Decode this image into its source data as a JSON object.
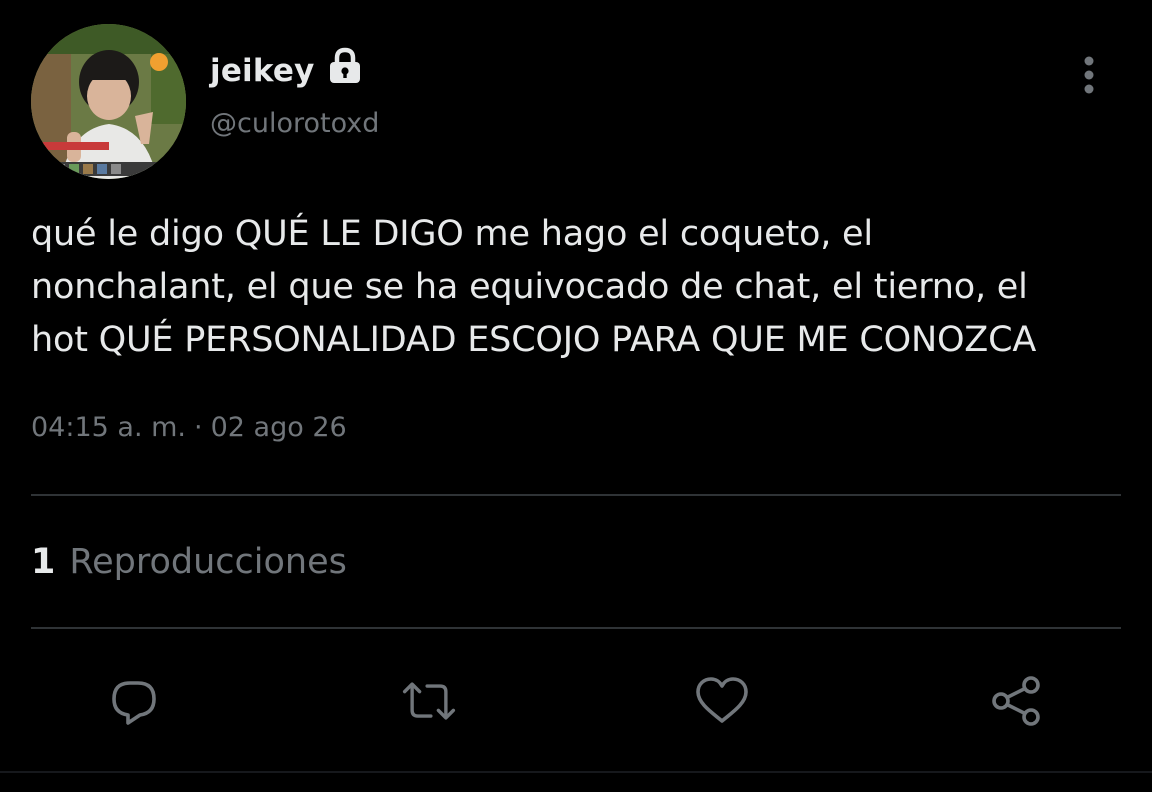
{
  "author": {
    "display_name": "jeikey",
    "handle": "@culorotoxd",
    "protected": true
  },
  "icons": {
    "lock": "lock-icon",
    "more": "more-vertical-icon",
    "reply": "reply-icon",
    "retweet": "retweet-icon",
    "like": "heart-icon",
    "share": "share-icon"
  },
  "tweet": {
    "text": "qué le digo QUÉ LE DIGO me hago el coqueto, el\nnonchalant, el que se ha equivocado de chat, el tierno, el\nhot QUÉ PERSONALIDAD ESCOJO PARA QUE ME CONOZCA",
    "time": "04:15 a. m.",
    "separator": "·",
    "date": "02 ago 26"
  },
  "stats": {
    "views_count": "1",
    "views_label": "Reproducciones"
  },
  "colors": {
    "background": "#000000",
    "primary_text": "#e7e9ea",
    "secondary_text": "#71767b",
    "divider": "#2f3336"
  }
}
